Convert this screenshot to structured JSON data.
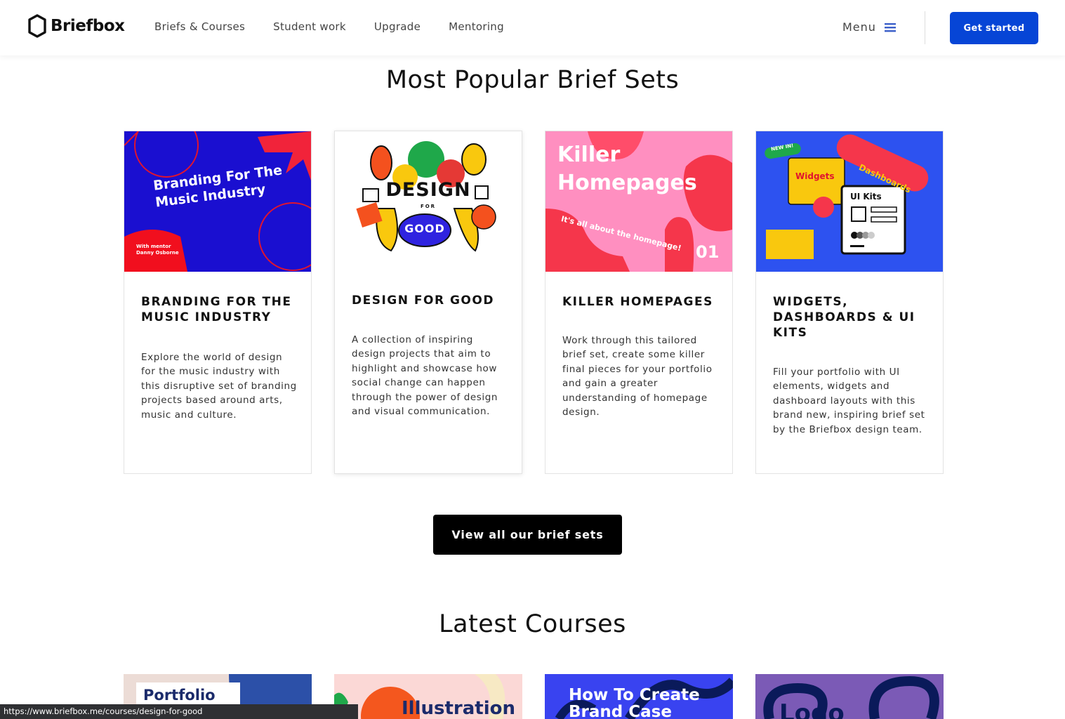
{
  "brand": {
    "name": "Briefbox",
    "accent": "#0645d6"
  },
  "nav": {
    "items": [
      "Briefs & Courses",
      "Student work",
      "Upgrade",
      "Mentoring"
    ],
    "menu_label": "Menu",
    "cta_label": "Get started"
  },
  "popular": {
    "title": "Most Popular Brief Sets",
    "cards": [
      {
        "title": "BRANDING FOR THE MUSIC INDUSTRY",
        "description": "Explore the world of design for the music industry with this disruptive set of branding projects based around arts, music and culture.",
        "thumb_heading": "Branding For The Music Industry",
        "thumb_sub": "With mentor Danny Osborne"
      },
      {
        "title": "DESIGN FOR GOOD",
        "description": "A collection of inspiring design projects that aim to highlight and showcase how social change can happen through the power of design and visual communication.",
        "thumb_word1": "DESIGN",
        "thumb_word2": "FOR",
        "thumb_word3": "GOOD"
      },
      {
        "title": "KILLER HOMEPAGES",
        "description": "Work through this tailored brief set, create some killer final pieces for your portfolio and gain a greater understanding of homepage design.",
        "thumb_heading": "Killer Homepages",
        "thumb_tagline": "It's all about the homepage!",
        "thumb_number": "01"
      },
      {
        "title": "WIDGETS, DASHBOARDS & UI KITS",
        "description": "Fill your portfolio with UI elements, widgets and dashboard layouts with this brand new, inspiring brief set by the Briefbox design team.",
        "thumb_badge": "NEW IN!",
        "thumb_widgets": "Widgets",
        "thumb_dashboards": "Dashboards",
        "thumb_uikits": "UI Kits"
      }
    ],
    "view_all_label": "View all our brief sets"
  },
  "courses": {
    "title": "Latest Courses",
    "items": [
      "Portfolio",
      "Illustration",
      "How To Create Brand Case",
      "Logo"
    ]
  },
  "status_url": "https://www.briefbox.me/courses/design-for-good"
}
